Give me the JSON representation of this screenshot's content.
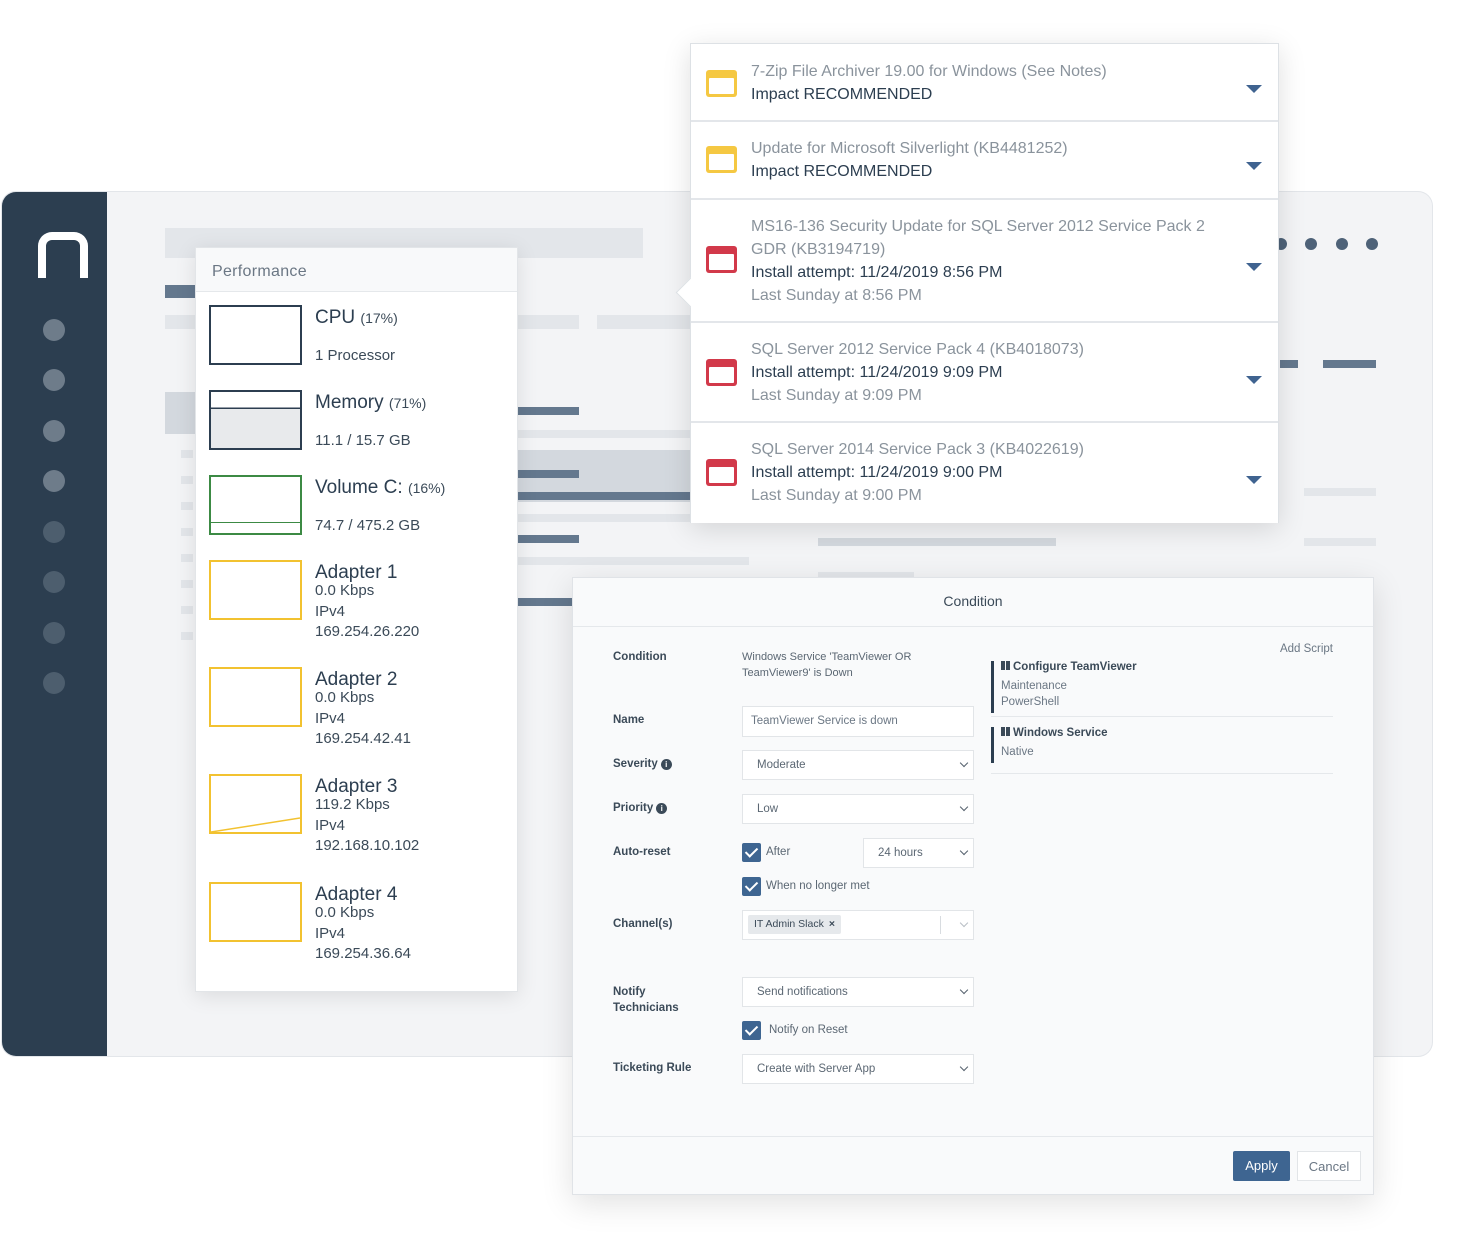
{
  "performance": {
    "title": "Performance",
    "metrics": [
      {
        "name": "CPU",
        "pct": "(17%)",
        "lines": [
          "1 Processor"
        ]
      },
      {
        "name": "Memory",
        "pct": "(71%)",
        "lines": [
          "11.1 / 15.7 GB"
        ]
      },
      {
        "name": "Volume C:",
        "pct": "(16%)",
        "lines": [
          "74.7 / 475.2 GB"
        ]
      },
      {
        "name": "Adapter 1",
        "lines": [
          "0.0 Kbps",
          "IPv4",
          "169.254.26.220"
        ]
      },
      {
        "name": "Adapter 2",
        "lines": [
          "0.0 Kbps",
          "IPv4",
          "169.254.42.41"
        ]
      },
      {
        "name": "Adapter 3",
        "lines": [
          "119.2 Kbps",
          "IPv4",
          "192.168.10.102"
        ]
      },
      {
        "name": "Adapter 4",
        "lines": [
          "0.0 Kbps",
          "IPv4",
          "169.254.36.64"
        ]
      }
    ]
  },
  "updates": [
    {
      "icon": "pending-window-icon",
      "title": "7-Zip File Archiver 19.00 for Windows (See Notes)",
      "line2": "Impact RECOMMENDED"
    },
    {
      "icon": "pending-window-icon",
      "title": "Update for Microsoft Silverlight (KB4481252)",
      "line2": "Impact RECOMMENDED"
    },
    {
      "icon": "failed-window-icon",
      "title": "MS16-136 Security Update for SQL Server 2012 Service Pack 2",
      "title2": "GDR (KB3194719)",
      "line2": "Install attempt: 11/24/2019 8:56 PM",
      "line3": "Last Sunday at 8:56 PM"
    },
    {
      "icon": "failed-window-icon",
      "title": "SQL Server 2012 Service Pack 4 (KB4018073)",
      "line2": "Install attempt: 11/24/2019 9:09 PM",
      "line3": "Last Sunday at 9:09 PM"
    },
    {
      "icon": "failed-window-icon",
      "title": "SQL Server 2014 Service Pack 3 (KB4022619)",
      "line2": "Install attempt: 11/24/2019 9:00 PM",
      "line3": "Last Sunday at 9:00 PM"
    }
  ],
  "condition": {
    "title": "Condition",
    "labels": {
      "condition": "Condition",
      "name": "Name",
      "severity": "Severity",
      "priority": "Priority",
      "auto_reset": "Auto-reset",
      "channels": "Channel(s)",
      "notify_1": "Notify",
      "notify_2": "Technicians",
      "ticketing": "Ticketing Rule"
    },
    "condition_text_1": "Windows Service 'TeamViewer OR",
    "condition_text_2": "TeamViewer9' is Down",
    "name_value": "TeamViewer Service is down",
    "severity_value": "Moderate",
    "priority_value": "Low",
    "after_label": "After",
    "after_value": "24 hours",
    "when_no_longer_met": "When no longer met",
    "channel_tag": "IT Admin Slack",
    "channel_tag_remove": "×",
    "notify_value": "Send notifications",
    "notify_on_reset": "Notify on Reset",
    "ticketing_value": "Create with Server App",
    "add_script": "Add Script",
    "scripts": [
      {
        "name": "Configure TeamViewer",
        "desc1": "Maintenance",
        "desc2": "PowerShell"
      },
      {
        "name": "Windows Service",
        "desc1": "Native"
      }
    ],
    "apply_label": "Apply",
    "cancel_label": "Cancel"
  },
  "colors": {
    "sidebar": "#2c3e50",
    "primary": "#3e6591",
    "warning": "#f5c842",
    "danger": "#d2394a",
    "volume": "#3c8a44"
  }
}
